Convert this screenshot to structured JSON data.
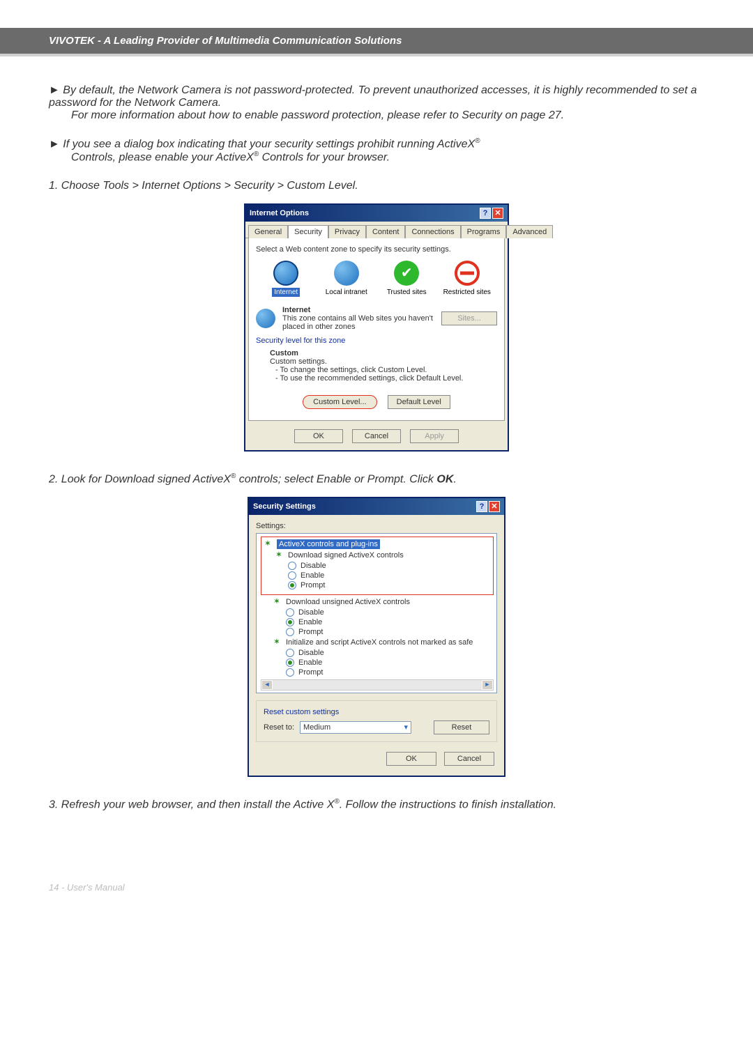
{
  "header": {
    "title": "VIVOTEK - A Leading Provider of Multimedia Communication Solutions"
  },
  "body": {
    "p1_lead": "► By default, the Network Camera is not password-protected. To prevent unauthorized accesses, it is highly recommended to set a password for the Network Camera.",
    "p1_follow1": "For more information about how to enable password protection, ",
    "p1_follow2": "please refer to Security on page 27.",
    "p2_a": "► If you see a dialog box indicating that your security settings prohibit running ActiveX",
    "p2_b": " Controls, please enable your ActiveX",
    "p2_c": " Controls for your browser.",
    "sup": "®",
    "step1": "1. Choose Tools > Internet Options > Security > Custom Level.",
    "step2a": "2. Look for Download signed ActiveX",
    "step2b": " controls; select Enable or Prompt. Click ",
    "step2c": "OK",
    "step2d": ".",
    "step3a": "3. Refresh your web browser, and then install the Active X",
    "step3b": ". Follow the instructions to finish installation."
  },
  "io": {
    "title": "Internet Options",
    "tabs": {
      "general": "General",
      "security": "Security",
      "privacy": "Privacy",
      "content": "Content",
      "connections": "Connections",
      "programs": "Programs",
      "advanced": "Advanced"
    },
    "select_zone": "Select a Web content zone to specify its security settings.",
    "zones": {
      "internet": "Internet",
      "local": "Local intranet",
      "trusted": "Trusted sites",
      "restricted": "Restricted sites"
    },
    "info_title": "Internet",
    "info_desc": "This zone contains all Web sites you haven't placed in other zones",
    "sites_btn": "Sites...",
    "sec_level_label": "Security level for this zone",
    "custom_title": "Custom",
    "custom_sub": "Custom settings.",
    "custom_l1": "- To change the settings, click Custom Level.",
    "custom_l2": "- To use the recommended settings, click Default Level.",
    "custom_level_btn": "Custom Level...",
    "default_level_btn": "Default Level",
    "ok": "OK",
    "cancel": "Cancel",
    "apply": "Apply"
  },
  "ss": {
    "title": "Security Settings",
    "settings_label": "Settings:",
    "root": "ActiveX controls and plug-ins",
    "n1": "Download signed ActiveX controls",
    "n2": "Download unsigned ActiveX controls",
    "n3": "Initialize and script ActiveX controls not marked as safe",
    "opt_disable": "Disable",
    "opt_enable": "Enable",
    "opt_prompt": "Prompt",
    "reset_group": "Reset custom settings",
    "reset_to": "Reset to:",
    "reset_value": "Medium",
    "reset_btn": "Reset",
    "ok": "OK",
    "cancel": "Cancel"
  },
  "footer": {
    "text": "14 - User's Manual"
  }
}
